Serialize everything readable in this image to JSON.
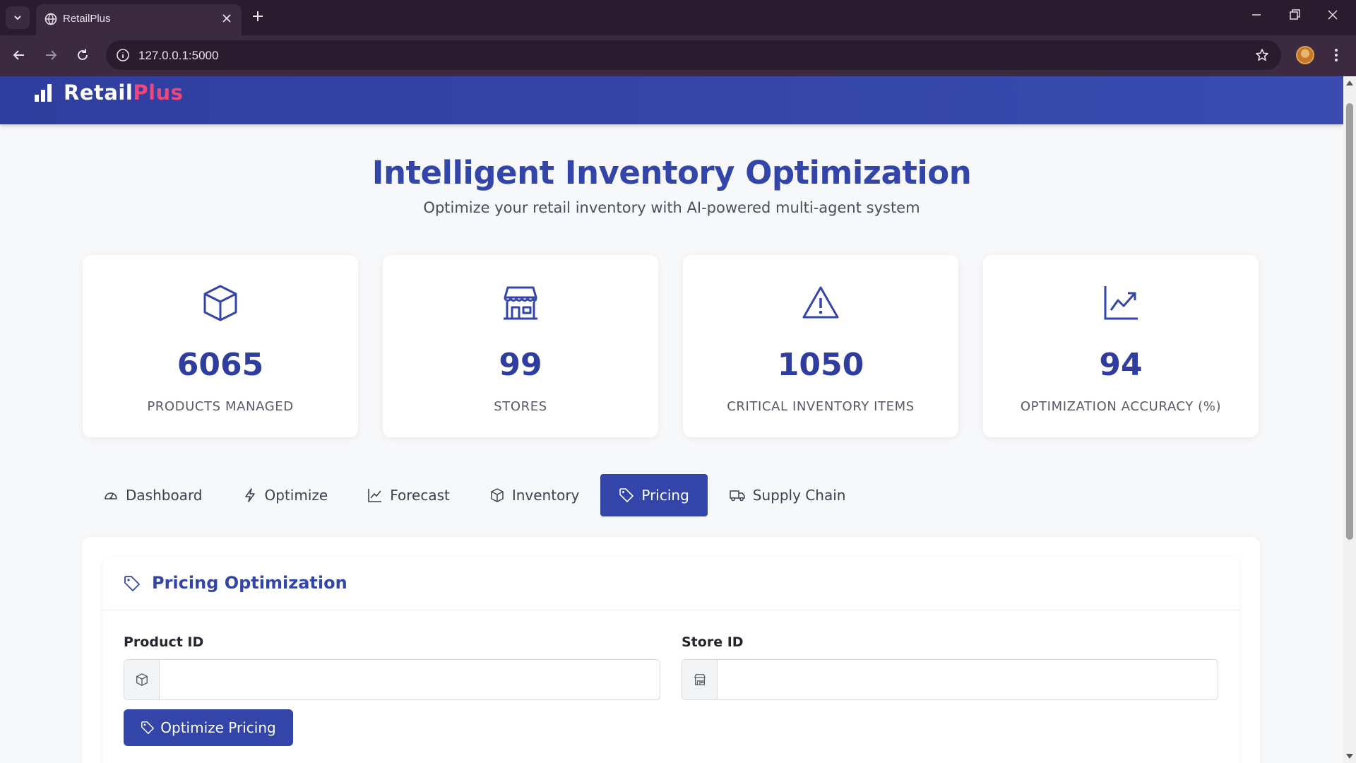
{
  "browser": {
    "tab_title": "RetailPlus",
    "url": "127.0.0.1:5000"
  },
  "header": {
    "brand_main": "Retail",
    "brand_accent": "Plus",
    "brand_accent_color": "#f0457a"
  },
  "hero": {
    "title": "Intelligent Inventory Optimization",
    "subtitle": "Optimize your retail inventory with AI-powered multi-agent system"
  },
  "stats": [
    {
      "icon": "box-icon",
      "value": "6065",
      "label": "PRODUCTS MANAGED"
    },
    {
      "icon": "store-icon",
      "value": "99",
      "label": "STORES"
    },
    {
      "icon": "warning-icon",
      "value": "1050",
      "label": "CRITICAL INVENTORY ITEMS"
    },
    {
      "icon": "chart-up-icon",
      "value": "94",
      "label": "OPTIMIZATION ACCURACY (%)"
    }
  ],
  "tabs": [
    {
      "icon": "gauge-icon",
      "label": "Dashboard",
      "active": false
    },
    {
      "icon": "bolt-icon",
      "label": "Optimize",
      "active": false
    },
    {
      "icon": "line-chart-icon",
      "label": "Forecast",
      "active": false
    },
    {
      "icon": "box-icon",
      "label": "Inventory",
      "active": false
    },
    {
      "icon": "tag-icon",
      "label": "Pricing",
      "active": true
    },
    {
      "icon": "truck-icon",
      "label": "Supply Chain",
      "active": false
    }
  ],
  "pricing": {
    "title": "Pricing Optimization",
    "product_label": "Product ID",
    "product_value": "",
    "store_label": "Store ID",
    "store_value": "",
    "button_label": "Optimize Pricing"
  },
  "colors": {
    "primary": "#3345a8",
    "accent": "#f0457a"
  }
}
